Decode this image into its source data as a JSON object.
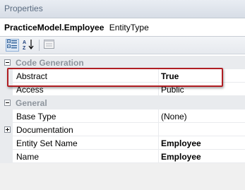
{
  "window": {
    "title": "Properties"
  },
  "selector": {
    "object_name": "PracticeModel.Employee",
    "object_type": "EntityType"
  },
  "toolbar": {
    "buttons": [
      {
        "icon": "categorized-icon",
        "active": true
      },
      {
        "icon": "alphabetical-sort-icon",
        "active": false
      },
      {
        "icon": "property-pages-icon",
        "active": false
      }
    ]
  },
  "grid": {
    "categories": [
      {
        "label": "Code Generation",
        "expanded": true,
        "properties": [
          {
            "name": "Abstract",
            "value": "True",
            "bold": true,
            "highlighted": true
          },
          {
            "name": "Access",
            "value": "Public",
            "bold": false
          }
        ]
      },
      {
        "label": "General",
        "expanded": true,
        "properties": [
          {
            "name": "Base Type",
            "value": "(None)",
            "bold": false
          },
          {
            "name": "Documentation",
            "value": "",
            "bold": false,
            "expandable": true
          },
          {
            "name": "Entity Set Name",
            "value": "Employee",
            "bold": true
          },
          {
            "name": "Name",
            "value": "Employee",
            "bold": true
          }
        ]
      }
    ]
  },
  "colors": {
    "highlight_border": "#b01e23",
    "category_text": "#8e959d",
    "gutter": "#e9ebee",
    "title_text": "#5a6b80"
  }
}
